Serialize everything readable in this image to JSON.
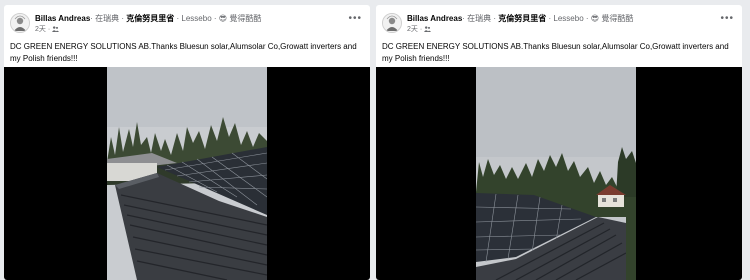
{
  "posts": [
    {
      "author": "Billas Andreas",
      "in_label": "· 在瑞典 · ",
      "place": "克倫努貝里省",
      "sep2": " · ",
      "city": "Lessebo",
      "feeling_prefix": " · ",
      "feeling_emoji": "😎",
      "feeling": " 覺得酷酷",
      "time": "2天 ·",
      "privacy_icon": "friends-icon",
      "more_label": "•••",
      "caption": "DC GREEN ENERGY SOLUTIONS AB.Thanks Bluesun solar,Alumsolar Co,Growatt inverters and my Polish friends!!!",
      "media_kind": "video-still"
    },
    {
      "author": "Billas Andreas",
      "in_label": "· 在瑞典 · ",
      "place": "克倫努貝里省",
      "sep2": " · ",
      "city": "Lessebo",
      "feeling_prefix": " · ",
      "feeling_emoji": "😎",
      "feeling": " 覺得酷酷",
      "time": "2天 ·",
      "privacy_icon": "friends-icon",
      "more_label": "•••",
      "caption": "DC GREEN ENERGY SOLUTIONS AB.Thanks Bluesun solar,Alumsolar Co,Growatt inverters and my Polish friends!!!",
      "media_kind": "video-still"
    }
  ],
  "colors": {
    "page_bg": "#e9ebee",
    "card_bg": "#ffffff",
    "text_primary": "#050505",
    "text_secondary": "#65676b",
    "video_bg": "#000000"
  }
}
